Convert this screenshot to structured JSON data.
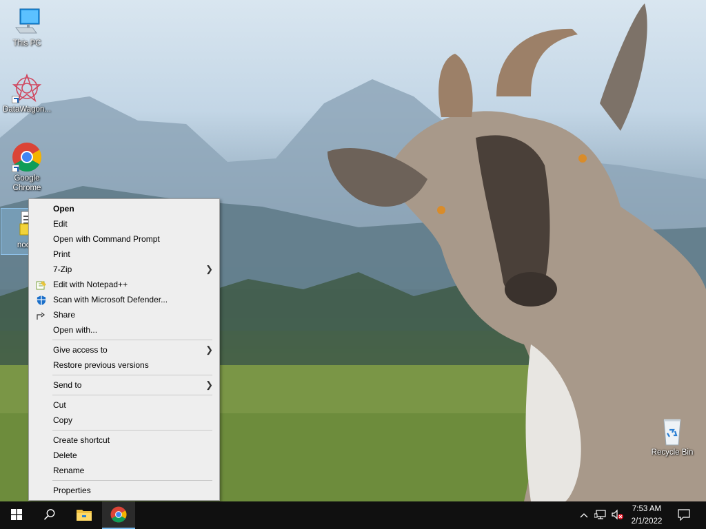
{
  "desktop": {
    "icons": [
      {
        "label": "This PC"
      },
      {
        "label": "DataWagon..."
      },
      {
        "label": "Google Chrome"
      },
      {
        "label": "nodej"
      },
      {
        "label": "Recycle Bin"
      }
    ]
  },
  "context_menu": {
    "items": [
      {
        "label": "Open"
      },
      {
        "label": "Edit"
      },
      {
        "label": "Open with Command Prompt"
      },
      {
        "label": "Print"
      },
      {
        "label": "7-Zip"
      },
      {
        "label": "Edit with Notepad++"
      },
      {
        "label": "Scan with Microsoft Defender..."
      },
      {
        "label": "Share"
      },
      {
        "label": "Open with..."
      },
      {
        "label": "Give access to"
      },
      {
        "label": "Restore previous versions"
      },
      {
        "label": "Send to"
      },
      {
        "label": "Cut"
      },
      {
        "label": "Copy"
      },
      {
        "label": "Create shortcut"
      },
      {
        "label": "Delete"
      },
      {
        "label": "Rename"
      },
      {
        "label": "Properties"
      }
    ]
  },
  "taskbar": {
    "clock_time": "7:53 AM",
    "clock_date": "2/1/2022"
  },
  "icons": {
    "start": "windows-start-icon",
    "search": "search-icon",
    "explorer": "file-explorer-icon",
    "chrome": "chrome-icon",
    "tray_chevron": "chevron-up-icon",
    "network": "network-icon",
    "volume": "volume-muted-icon",
    "notifications": "notification-icon"
  },
  "colors": {
    "taskbar": "#101010",
    "menu_bg": "#eeeeee",
    "accent": "#76b9ed"
  }
}
